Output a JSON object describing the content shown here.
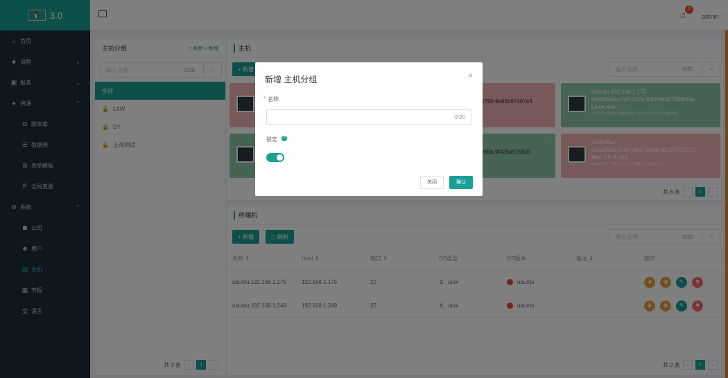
{
  "app": {
    "logo_mark": "🐧",
    "version": "3.0"
  },
  "sidebar": {
    "items": [
      {
        "icon": "home-icon",
        "glyph": "⌂",
        "label": "首页",
        "arrow": ""
      },
      {
        "icon": "flow-icon",
        "glyph": "♣",
        "label": "流程",
        "arrow": "⌄"
      },
      {
        "icon": "report-icon",
        "glyph": "▣",
        "label": "报表",
        "arrow": "⌄"
      },
      {
        "icon": "resource-icon",
        "glyph": "♠",
        "label": "资源",
        "arrow": "⌃"
      },
      {
        "icon": "script-icon",
        "glyph": "⧉",
        "label": "脚本库",
        "arrow": ""
      },
      {
        "icon": "datasource-icon",
        "glyph": "☰",
        "label": "数据源",
        "arrow": ""
      },
      {
        "icon": "form-template-icon",
        "glyph": "⊞",
        "label": "表单模板",
        "arrow": ""
      },
      {
        "icon": "global-var-icon",
        "glyph": "Ᵽ",
        "label": "全局变量",
        "arrow": ""
      },
      {
        "icon": "system-icon",
        "glyph": "⚙",
        "label": "系统",
        "arrow": "⌃"
      },
      {
        "icon": "company-icon",
        "glyph": "☗",
        "label": "公司",
        "arrow": ""
      },
      {
        "icon": "user-icon",
        "glyph": "☻",
        "label": "用户",
        "arrow": ""
      },
      {
        "icon": "host-icon",
        "glyph": "▤",
        "label": "主机",
        "arrow": ""
      },
      {
        "icon": "holiday-icon",
        "glyph": "▦",
        "label": "节假",
        "arrow": ""
      },
      {
        "icon": "language-icon",
        "glyph": "文",
        "label": "语言",
        "arrow": ""
      }
    ]
  },
  "topbar": {
    "toggle_icon": "menu-toggle-icon",
    "bell_count": "2",
    "user": "admin"
  },
  "group_panel": {
    "title": "主机分组",
    "actions": "◻ 刷新 + 新增",
    "search_placeholder": "输入名称",
    "counter": "0/20",
    "items": [
      {
        "lock": "",
        "label": "全部"
      },
      {
        "lock": "🔓",
        "label": "LXW"
      },
      {
        "lock": "🔒",
        "label": "DY"
      },
      {
        "lock": "🔓",
        "label": "上海测试"
      }
    ],
    "pager_total": "共 3 条",
    "pager_page": "1"
  },
  "host_panel": {
    "title": "主机",
    "add_label": "+ 新增",
    "search_placeholder": "输入名称",
    "counter": "0/20",
    "cards": [
      {
        "line1": "",
        "line2": "-8790-9a95b97467a3",
        "line3": "",
        "line4": ""
      },
      {
        "line1": "Ubuntu:192.168.1.175",
        "line2": "eb8b554e-c7d7-427e-90f2-b4827286f30a",
        "line3": "Linux x64",
        "line4": "hoanic-virtual-machine / Linux / 5.4.0-26-gener..."
      },
      {
        "line1": "",
        "line2": "-965b-9f425a975835",
        "line3": "",
        "line4": ""
      },
      {
        "line1": "LXW:Mac",
        "line2": "a2ca282e-0704-4d02-b9dd-98129033151f",
        "line3": "Mac OS X x64",
        "line4": "localhost / Mac OS X / x86_64 10.15.4"
      }
    ],
    "pager_total": "共 6 条",
    "pager_page": "1"
  },
  "terminal_panel": {
    "title": "终端机",
    "add_label": "+ 新增",
    "refresh_label": "◻ 刷新",
    "search_placeholder": "输入名称",
    "counter": "0/20",
    "columns": [
      "名称 ⇕",
      "Host ⇕",
      "端口 ⇕",
      "OS类型",
      "OS版本",
      "备注 ⇕",
      "操作"
    ],
    "rows": [
      {
        "name": "ubuntu:192.168.1.175",
        "host": "192.168.1.175",
        "port": "22",
        "os_type": "unix",
        "os_version": "ubuntu",
        "note": ""
      },
      {
        "name": "ubuntu:192.168.1.249",
        "host": "192.168.1.249",
        "port": "22",
        "os_type": "unix",
        "os_version": "ubuntu",
        "note": ""
      }
    ],
    "pager_total": "共 2 条",
    "pager_page": "1"
  },
  "modal": {
    "title": "新增 主机分组",
    "close": "×",
    "name_label": "名称",
    "name_required": "*",
    "counter": "0/20",
    "lock_label": "锁定",
    "lock_on": true,
    "cancel": "关闭",
    "confirm": "确认"
  },
  "colors": {
    "accent": "#1aa094",
    "sidebar": "#1f2d3d",
    "card_red": "#eeb3b3",
    "card_green": "#8fc6a8"
  }
}
